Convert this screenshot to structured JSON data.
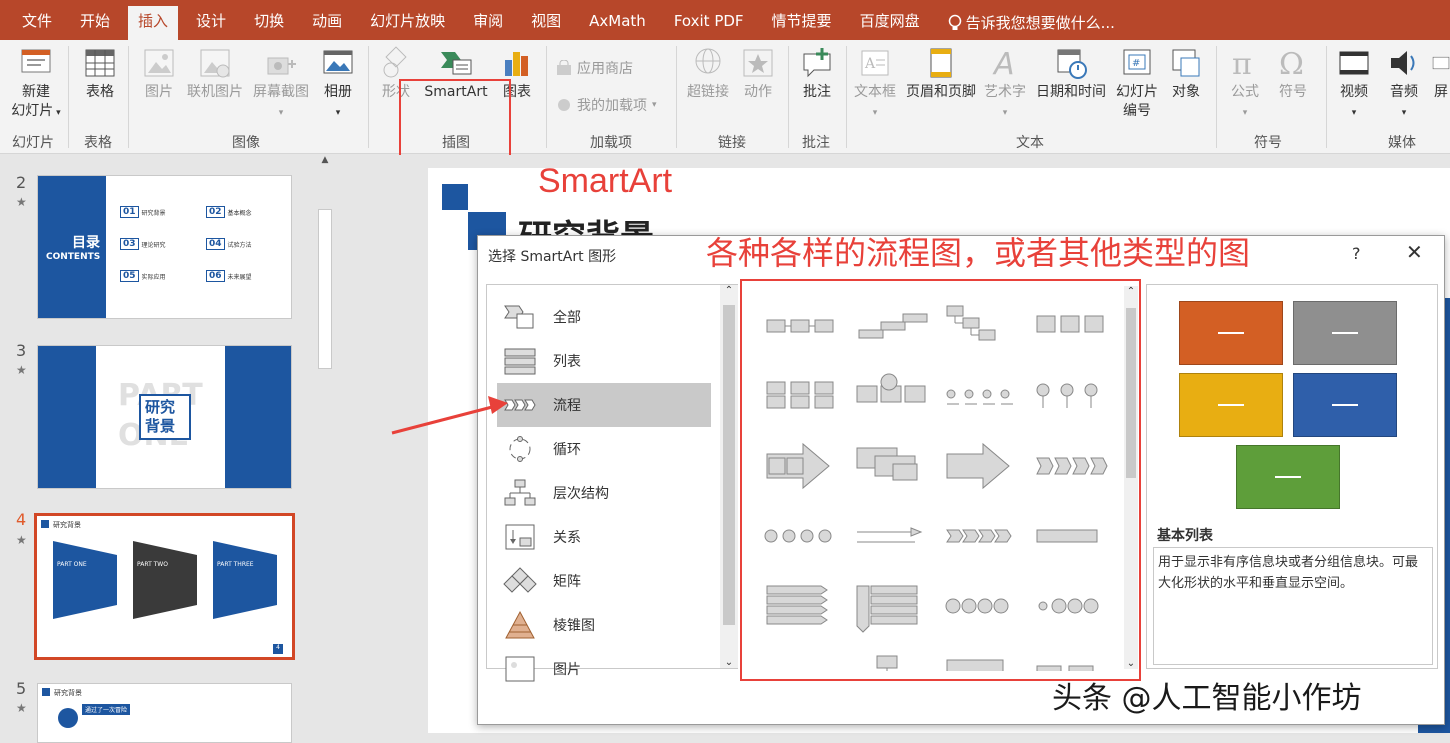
{
  "ribbon_tabs": [
    "文件",
    "开始",
    "插入",
    "设计",
    "切换",
    "动画",
    "幻灯片放映",
    "审阅",
    "视图",
    "AxMath",
    "Foxit PDF",
    "情节提要",
    "百度网盘"
  ],
  "tell_me": "告诉我您想要做什么...",
  "ribbon": {
    "new_slide": "新建\n幻灯片",
    "table": "表格",
    "picture": "图片",
    "online_picture": "联机图片",
    "screenshot": "屏幕截图",
    "album": "相册",
    "shapes": "形状",
    "smartart": "SmartArt",
    "chart": "图表",
    "app_store": "应用商店",
    "my_addins": "我的加载项",
    "hyperlink": "超链接",
    "action": "动作",
    "comment": "批注",
    "textbox": "文本框",
    "header_footer": "页眉和页脚",
    "wordart": "艺术字",
    "datetime": "日期和时间",
    "slide_number": "幻灯片\n编号",
    "object": "对象",
    "equation": "公式",
    "symbol": "符号",
    "video": "视频",
    "audio": "音频",
    "screen_record": "屏",
    "groups": {
      "slides": "幻灯片",
      "tables": "表格",
      "images": "图像",
      "illustrations": "插图",
      "addins": "加载项",
      "links": "链接",
      "comments": "批注",
      "text": "文本",
      "symbols": "符号",
      "media": "媒体"
    }
  },
  "slides": [
    {
      "num": "2",
      "title": "目录",
      "subtitle": "CONTENTS",
      "items": [
        {
          "n": "01",
          "t": "研究背景"
        },
        {
          "n": "02",
          "t": "基本概念"
        },
        {
          "n": "03",
          "t": "理论研究"
        },
        {
          "n": "04",
          "t": "试验方法"
        },
        {
          "n": "05",
          "t": "实际应用"
        },
        {
          "n": "06",
          "t": "未来展望"
        }
      ]
    },
    {
      "num": "3",
      "title": "研究\n背景",
      "bg": "PART\nONE"
    },
    {
      "num": "4",
      "title": "研究背景",
      "parts": [
        "PART ONE",
        "PART TWO",
        "PART THREE"
      ],
      "page": "4"
    },
    {
      "num": "5",
      "title": "研究背景",
      "note": "通过了一次冒险"
    }
  ],
  "canvas_title": "研究背景",
  "annotation_smartart": "SmartArt",
  "annotation_desc": "各种各样的流程图，或者其他类型的图",
  "dialog": {
    "title": "选择 SmartArt 图形",
    "help": "?",
    "close": "✕",
    "categories": [
      {
        "label": "全部",
        "icon": "all-icon"
      },
      {
        "label": "列表",
        "icon": "list-icon"
      },
      {
        "label": "流程",
        "icon": "process-icon",
        "selected": true
      },
      {
        "label": "循环",
        "icon": "cycle-icon"
      },
      {
        "label": "层次结构",
        "icon": "hierarchy-icon"
      },
      {
        "label": "关系",
        "icon": "relationship-icon"
      },
      {
        "label": "矩阵",
        "icon": "matrix-icon"
      },
      {
        "label": "棱锥图",
        "icon": "pyramid-icon"
      },
      {
        "label": "图片",
        "icon": "picture-icon"
      }
    ],
    "preview_name": "基本列表",
    "preview_desc": "用于显示非有序信息块或者分组信息块。可最大化形状的水平和垂直显示空间。",
    "preview_colors": [
      "#d35f24",
      "#8f8f8f",
      "#e8ae12",
      "#2f5faa",
      "#5e9e3a"
    ]
  },
  "watermark": "头条 @人工智能小作坊"
}
